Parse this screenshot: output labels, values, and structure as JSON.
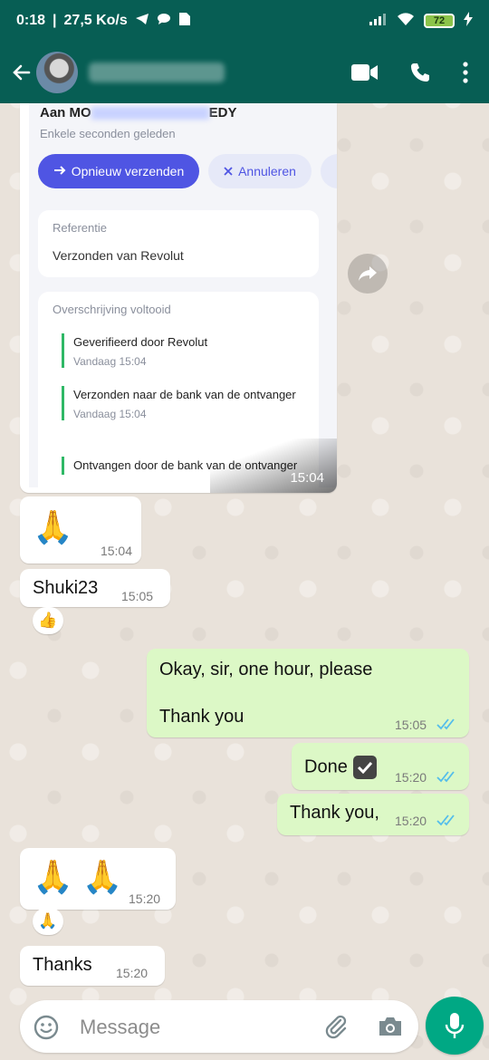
{
  "status_bar": {
    "time": "0:18",
    "speed": "27,5 Ko/s",
    "battery": "72"
  },
  "header": {
    "back_icon": "arrow-left-icon",
    "video_icon": "video-call-icon",
    "call_icon": "phone-icon",
    "menu_icon": "more-vertical-icon"
  },
  "image_message": {
    "to_prefix": "Aan MO",
    "to_suffix": "EDY",
    "time_ago": "Enkele seconden geleden",
    "resend_label": "Opnieuw verzenden",
    "cancel_label": "Annuleren",
    "reference_label": "Referentie",
    "reference_value": "Verzonden van Revolut",
    "transfer_label": "Overschrijving voltooid",
    "steps": [
      {
        "title": "Geverifieerd door Revolut",
        "time": "Vandaag 15:04"
      },
      {
        "title": "Verzonden naar de bank van de ontvanger",
        "time": "Vandaag 15:04"
      },
      {
        "title": "Ontvangen door de bank van de ontvanger",
        "time": ""
      }
    ],
    "time": "15:04"
  },
  "messages": [
    {
      "id": "m1",
      "direction": "in",
      "text": "🙏",
      "time": "15:04"
    },
    {
      "id": "m2",
      "direction": "in",
      "text": "Shuki23",
      "time": "15:05",
      "reaction": "👍"
    },
    {
      "id": "m3",
      "direction": "out",
      "line1": "Okay, sir, one hour, please",
      "line2": "Thank you",
      "time": "15:05"
    },
    {
      "id": "m4",
      "direction": "out",
      "text": "Done",
      "time": "15:20"
    },
    {
      "id": "m5",
      "direction": "out",
      "text": "Thank you,",
      "time": "15:20"
    },
    {
      "id": "m6",
      "direction": "in",
      "text": "🙏 🙏",
      "time": "15:20",
      "reaction": "🙏"
    },
    {
      "id": "m7",
      "direction": "in",
      "text": "Thanks",
      "time": "15:20"
    }
  ],
  "composer": {
    "placeholder": "Message"
  },
  "colors": {
    "header": "#075e54",
    "outgoing_bubble": "#dcf8c6",
    "read_ticks": "#53bdeb",
    "mic_button": "#00a884"
  }
}
